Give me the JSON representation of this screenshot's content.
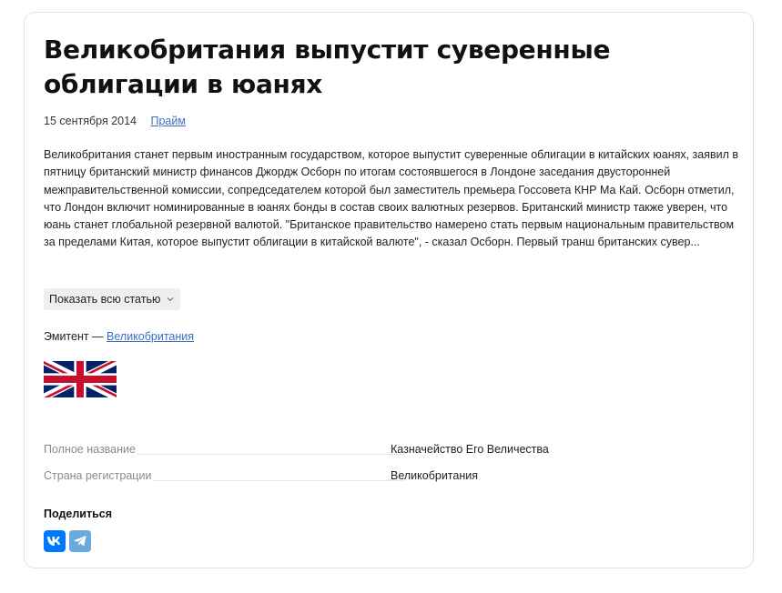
{
  "article": {
    "title": "Великобритания выпустит суверенные облигации в юанях",
    "date": "15 сентября 2014",
    "source": "Прайм",
    "body": "Великобритания станет первым иностранным государством, которое выпустит суверенные облигации в китайских юанях, заявил в пятницу британский министр финансов Джордж Осборн по итогам состоявшегося в Лондоне заседания двусторонней межправительственной комиссии, сопредседателем которой был заместитель премьера Госсовета КНР Ма Кай. Осборн отметил, что Лондон включит номинированные в юанях бонды в состав своих валютных резервов. Британский министр также уверен, что юань станет глобальной резервной валютой. \"Британское правительство намерено стать первым национальным правительством за пределами Китая, которое выпустит облигации в китайской валюте\", - сказал Осборн. Первый транш британских сувер...",
    "show_more_label": "Показать всю статью",
    "show_more_icon": "chevron-down-icon"
  },
  "emitent": {
    "label": "Эмитент —",
    "name": "Великобритания",
    "flag_icon": "uk-flag-icon"
  },
  "details": [
    {
      "label": "Полное название",
      "value": "Казначейство Его Величества"
    },
    {
      "label": "Страна регистрации",
      "value": "Великобритания"
    }
  ],
  "share": {
    "title": "Поделиться",
    "buttons": [
      {
        "name": "vk",
        "icon": "vk-icon",
        "color": "#0077ff"
      },
      {
        "name": "telegram",
        "icon": "telegram-icon",
        "color": "#6aa9dc"
      }
    ]
  },
  "colors": {
    "link": "#3b6fc4",
    "muted": "#8a8a8a"
  }
}
